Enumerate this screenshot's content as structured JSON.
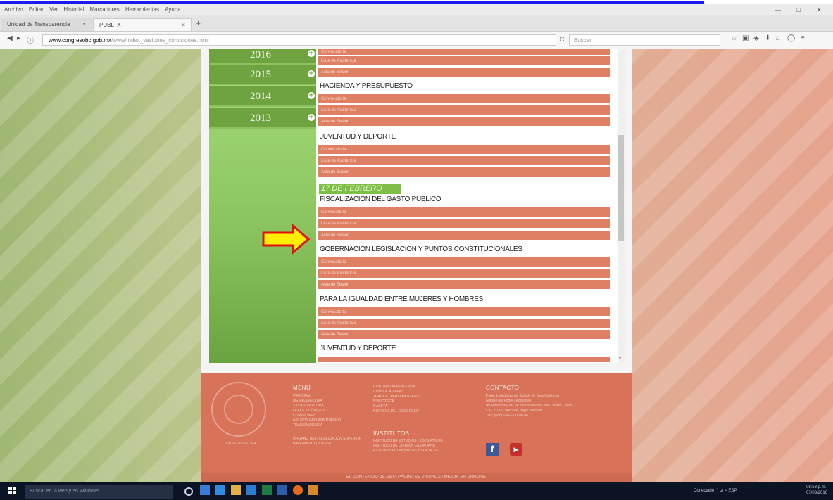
{
  "browser": {
    "menu": [
      "Archivo",
      "Editar",
      "Ver",
      "Historial",
      "Marcadores",
      "Herramientas",
      "Ayuda"
    ],
    "window_controls": "— □ ✕",
    "tabs": [
      {
        "label": "Unidad de Transparencia",
        "close": "×"
      },
      {
        "label": "PUBLTX",
        "close": "×"
      }
    ],
    "new_tab": "+",
    "url_domain": "www.congresobc.gob.mx",
    "url_path": "/www/index_sesiones_comisiones.html",
    "reload": "C",
    "search_placeholder": "Buscar"
  },
  "years": [
    "2016",
    "2015",
    "2014",
    "2013"
  ],
  "plus_glyph": "+",
  "items": {
    "convocatoria": "Convocatoria",
    "asistencia": "Lista de Asistencia",
    "acta": "Acta de Sesión"
  },
  "headings": [
    "HACIENDA Y PRESUPUESTO",
    "JUVENTUD Y DEPORTE",
    "FISCALIZACIÓN DEL GASTO PÚBLICO",
    "GOBERNACIÓN LEGISLACIÓN Y PUNTOS CONSTITUCIONALES",
    "PARA LA IGUALDAD ENTRE MUJERES Y HOMBRES",
    "JUVENTUD Y DEPORTE"
  ],
  "date_badge": "17 DE FEBRERO",
  "footer": {
    "menu_title": "MENÚ",
    "menu_items": [
      "PRINCIPAL",
      "MESA DIRECTIVA",
      "XXI LEGISLATURA",
      "LEYES Y CÓDIGOS",
      "COMISIONES",
      "GRUPOS PARLAMENTARIOS",
      "TRANSPARENCIA",
      "",
      "ÓRGANO DE FISCALIZACIÓN SUPERIOR",
      "PARLAMENTO JUVENIL"
    ],
    "col2_items": [
      "CONTRALORÍA INTERNA",
      "CONVOCATORIAS",
      "TRABAJO PARLAMENTARIO",
      "BIBLIOTECA",
      "GACETA",
      "HISTORIA DEL CONGRESO"
    ],
    "institutos_title": "INSTITUTOS",
    "institutos_items": [
      "INSTITUTO DE ESTUDIOS LEGISLATIVOS",
      "INSTITUTO DE OPINIÓN CIUDADANA",
      "ESTUDIOS ECONÓMICOS Y SOCIALES"
    ],
    "contacto_title": "CONTACTO",
    "contacto_items": [
      "Poder Legislativo del Estado de Baja California",
      "Edificio del Poder Legislativo",
      "Av. Pioneros y Av. de los Héroes No. 995 Centro Cívico",
      "C.P. 21000, Mexicali, Baja California",
      "Tels: (686) 558-91-00 al 04"
    ],
    "seal_text": "XXI LEGISLATURA",
    "fb": "f",
    "yt": "▶",
    "strip": "EL CONTENIDO DE ESTA PÁGINA SE VISUALIZA MEJOR EN CHROME"
  },
  "taskbar": {
    "search_placeholder": "Buscar en la web y en Windows",
    "tray": "Conectado  ⌃  ⊿  ⌁  ESP",
    "time": "08:53 p.m.",
    "date": "07/03/2016"
  },
  "colors": {
    "arrow_fill": "#ffee00",
    "arrow_stroke": "#e01010"
  }
}
